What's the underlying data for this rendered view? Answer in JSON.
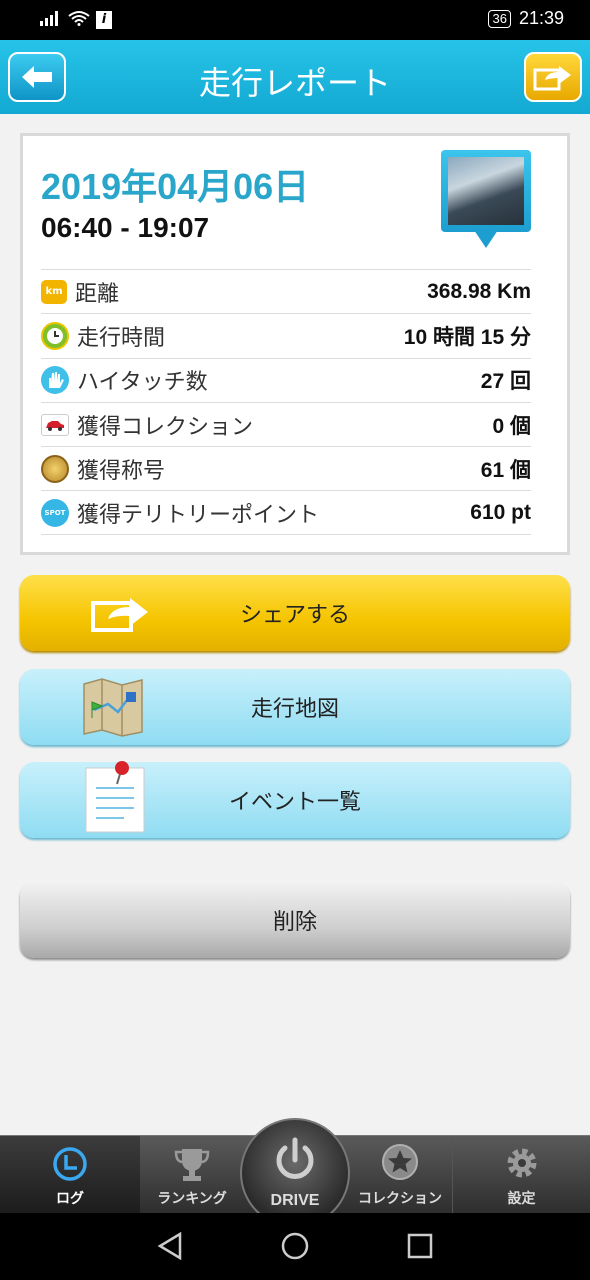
{
  "status_bar": {
    "battery": "36",
    "time": "21:39"
  },
  "header": {
    "title": "走行レポート"
  },
  "report": {
    "date": "2019年04月06日",
    "time_range": "06:40 - 19:07",
    "rows": [
      {
        "icon": "km-badge-icon",
        "label": "距離",
        "value": "368.98 Km"
      },
      {
        "icon": "clock-icon",
        "label": "走行時間",
        "value": "10 時間 15 分"
      },
      {
        "icon": "hand-wave-icon",
        "label": "ハイタッチ数",
        "value": "27 回"
      },
      {
        "icon": "car-card-icon",
        "label": "獲得コレクション",
        "value": "0 個"
      },
      {
        "icon": "medal-icon",
        "label": "獲得称号",
        "value": "61 個"
      },
      {
        "icon": "spot-badge-icon",
        "label": "獲得テリトリーポイント",
        "value": "610 pt"
      }
    ],
    "km_icon_text": "km",
    "spot_icon_text": "SPOT"
  },
  "buttons": {
    "share": "シェアする",
    "map": "走行地図",
    "events": "イベント一覧",
    "delete": "削除"
  },
  "tabs": [
    {
      "label": "ログ",
      "icon": "clock-icon"
    },
    {
      "label": "ランキング",
      "icon": "trophy-icon"
    },
    {
      "label": "DRIVE",
      "icon": "power-icon"
    },
    {
      "label": "コレクション",
      "icon": "star-badge-icon"
    },
    {
      "label": "設定",
      "icon": "gear-icon"
    }
  ],
  "colors": {
    "header": "#1db4dd",
    "date": "#29a6c9",
    "share_button": "#f5c400",
    "map_button": "#a6e3f5"
  }
}
